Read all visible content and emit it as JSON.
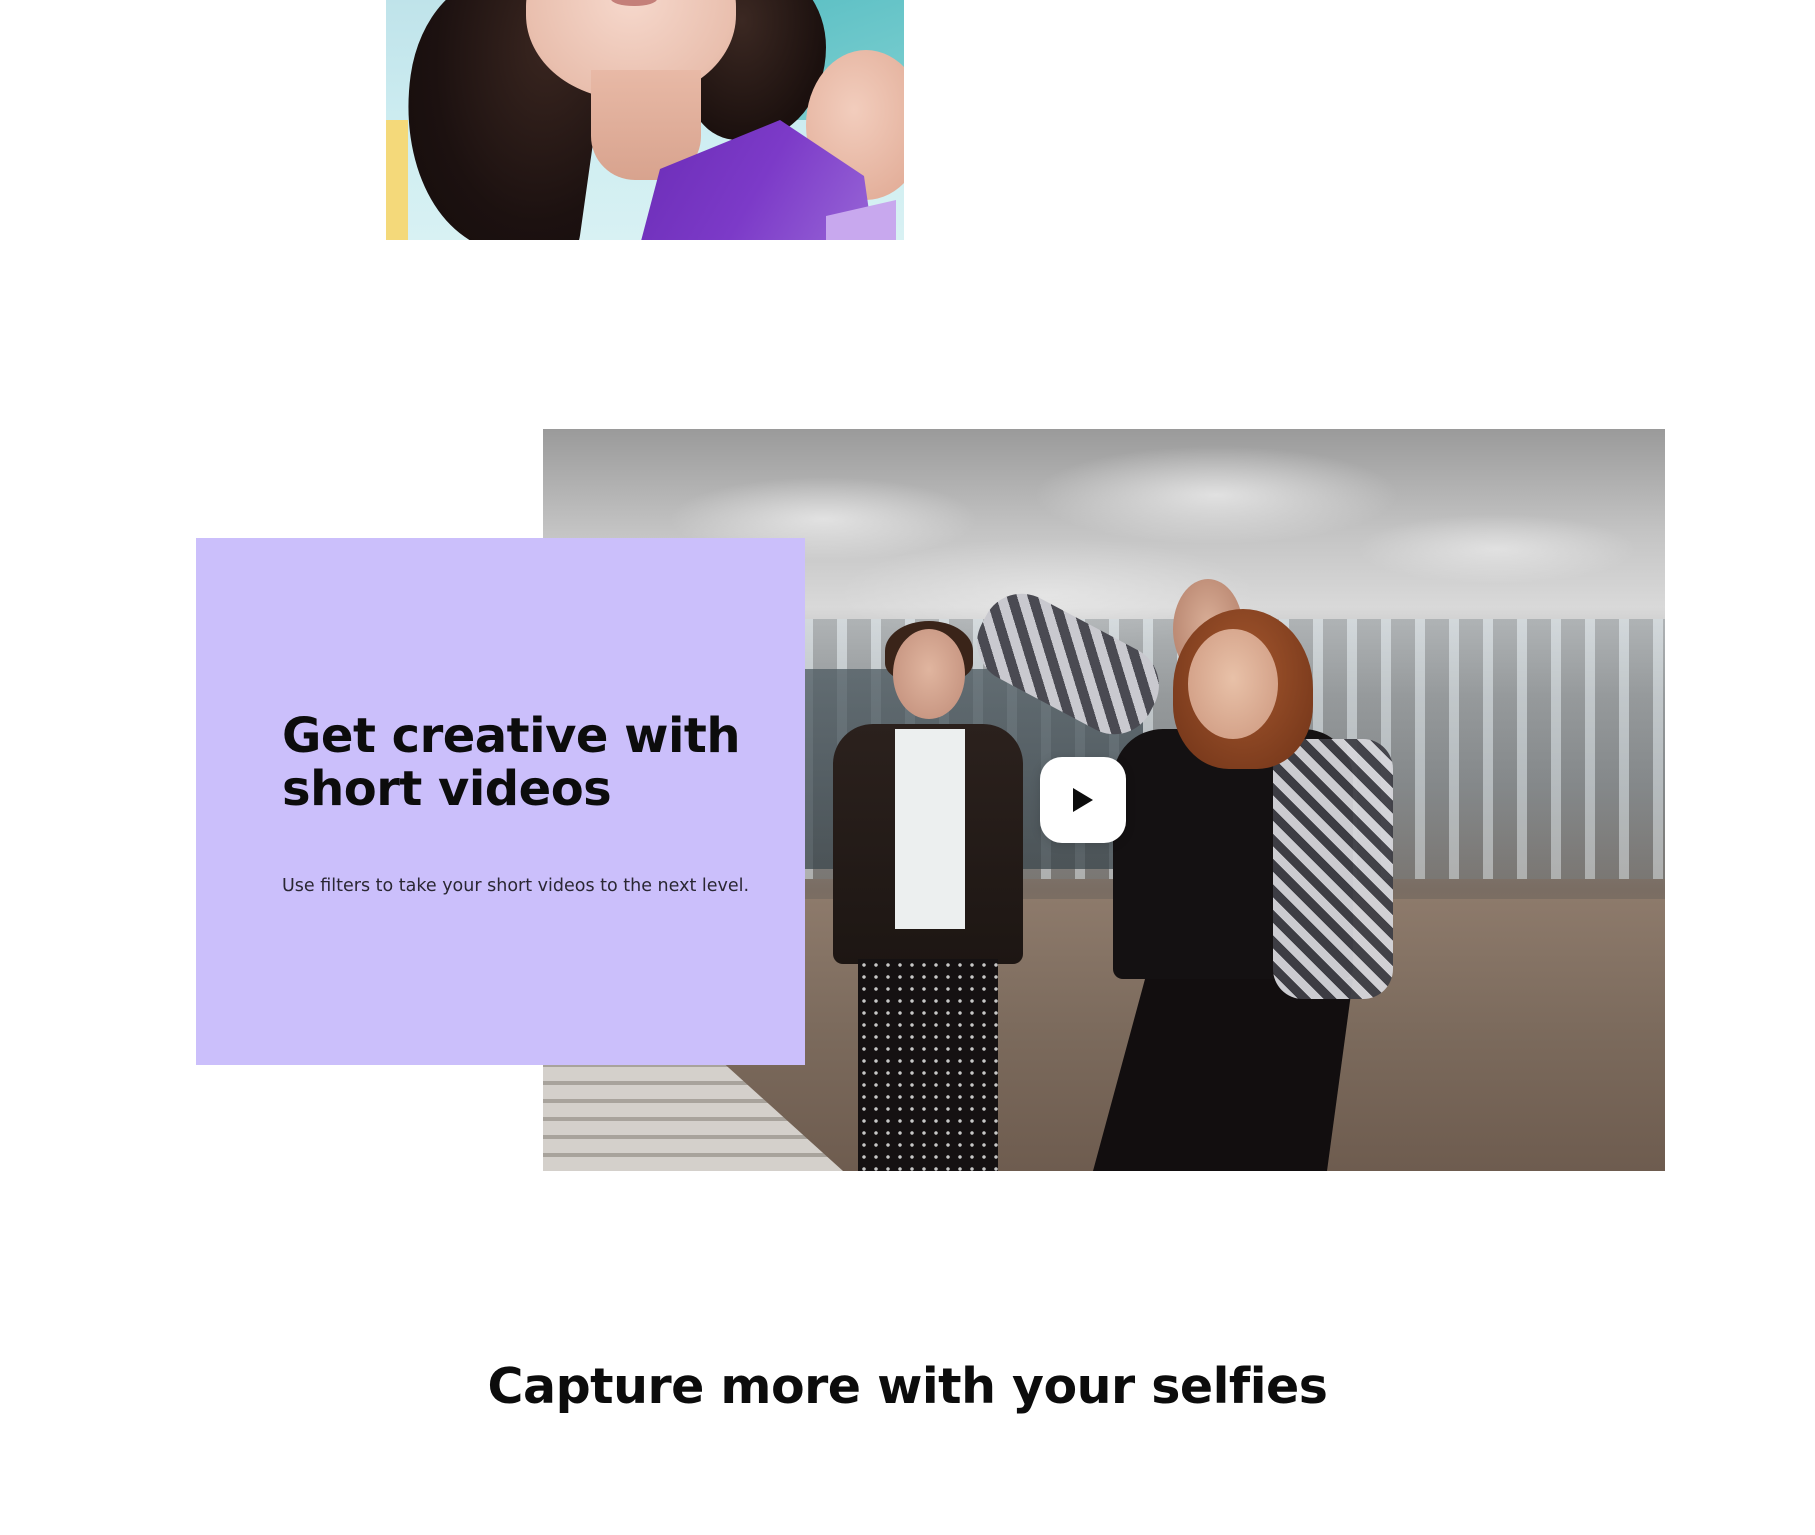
{
  "top_image": {
    "alt": "Woman in purple top"
  },
  "feature": {
    "title": "Get creative with short videos",
    "description": "Use filters to take your short videos to the next level.",
    "video_alt": "Group of friends dancing outdoors",
    "play_icon": "play-icon"
  },
  "next_section": {
    "heading": "Capture more with your selfies"
  },
  "colors": {
    "card_background": "#cbbffb",
    "text": "#0c0c0c",
    "body_text": "#2a2733",
    "play_button": "#ffffff"
  }
}
